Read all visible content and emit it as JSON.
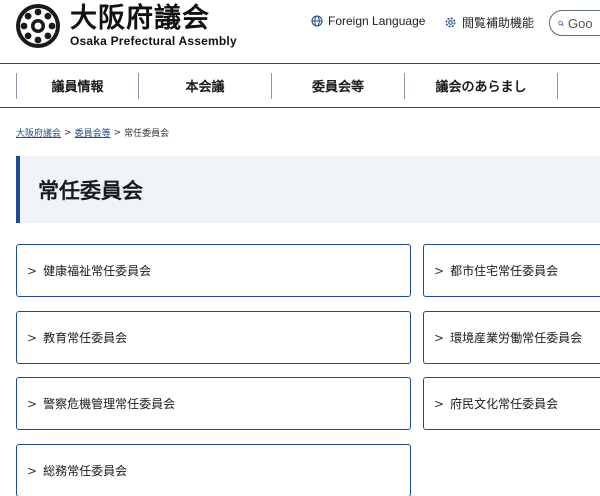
{
  "header": {
    "logo_title": "大阪府議会",
    "logo_subtitle": "Osaka Prefectural Assembly",
    "foreign_language": "Foreign Language",
    "accessibility": "閲覧補助機能",
    "search_placeholder": "Goo"
  },
  "nav": {
    "items": [
      {
        "label": "議員情報"
      },
      {
        "label": "本会議"
      },
      {
        "label": "委員会等"
      },
      {
        "label": "議会のあらまし"
      },
      {
        "label": ""
      }
    ]
  },
  "breadcrumb": {
    "items": [
      {
        "label": "大阪府議会"
      },
      {
        "label": "委員会等"
      },
      {
        "label": "常任委員会"
      }
    ],
    "separator": ">"
  },
  "page_title": "常任委員会",
  "committees": {
    "left": [
      {
        "label": "健康福祉常任委員会"
      },
      {
        "label": "教育常任委員会"
      },
      {
        "label": "警察危機管理常任委員会"
      },
      {
        "label": "総務常任委員会"
      }
    ],
    "right": [
      {
        "label": "都市住宅常任委員会"
      },
      {
        "label": "環境産業労働常任委員会"
      },
      {
        "label": "府民文化常任委員会"
      }
    ],
    "chevron": ">"
  },
  "colors": {
    "primary": "#1f4b8f",
    "title_bg": "#f0f3f7",
    "text": "#1a1a1a"
  }
}
